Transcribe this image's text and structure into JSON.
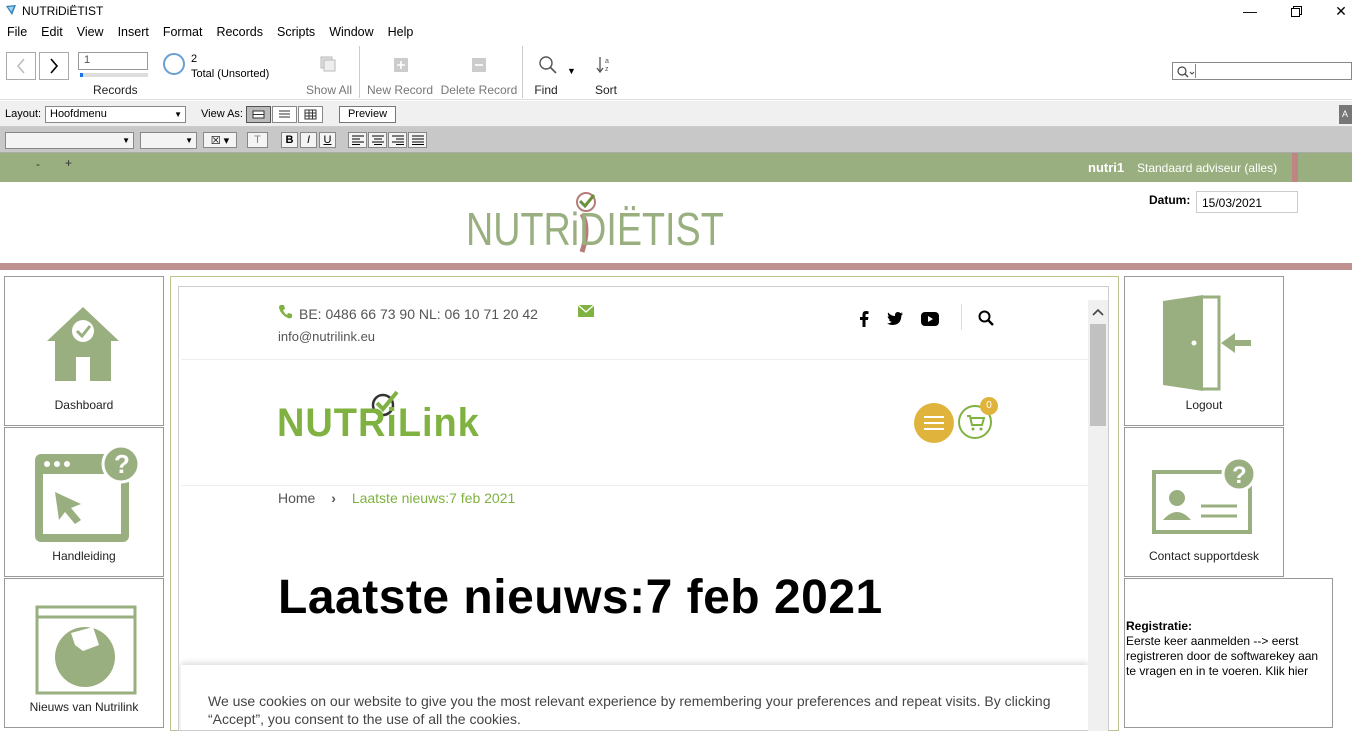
{
  "window": {
    "title": "NUTRiDiËTIST"
  },
  "menu": [
    "File",
    "Edit",
    "View",
    "Insert",
    "Format",
    "Records",
    "Scripts",
    "Window",
    "Help"
  ],
  "toolbar": {
    "record_number": "1",
    "records_label": "Records",
    "total_count": "2",
    "total_label": "Total (Unsorted)",
    "show_all": "Show All",
    "new_record": "New Record",
    "delete_record": "Delete Record",
    "find": "Find",
    "sort": "Sort"
  },
  "layoutbar": {
    "layout_label": "Layout:",
    "layout_value": "Hoofdmenu",
    "view_as_label": "View As:",
    "preview": "Preview",
    "side_button": "A"
  },
  "formatbar": {
    "bold": "B",
    "italic": "I",
    "underline": "U",
    "text_btn": "T"
  },
  "header": {
    "minus": "-",
    "plus": "+",
    "user": "nutri1",
    "role": "Standaard adviseur (alles)",
    "logo_text": "NUTRiDIËTIST",
    "datum_label": "Datum:",
    "datum_value": "15/03/2021"
  },
  "tiles_left": [
    {
      "label": "Dashboard",
      "icon": "home-check-icon"
    },
    {
      "label": "Handleiding",
      "icon": "manual-help-icon"
    },
    {
      "label": "Nieuws van Nutrilink",
      "icon": "news-icon"
    }
  ],
  "tiles_right": [
    {
      "label": "Logout",
      "icon": "logout-door-icon"
    },
    {
      "label": "Contact supportdesk",
      "icon": "support-card-icon"
    }
  ],
  "registration": {
    "title": "Registratie:",
    "text": "Eerste keer aanmelden -->  eerst registreren door de softwarekey aan te vragen en in te voeren. Klik hier"
  },
  "web": {
    "phone": "BE: 0486 66 73 90 NL: 06 10 71 20 42",
    "email": "info@nutrilink.eu",
    "logo_text": "NUTRiLink",
    "cart_count": "0",
    "breadcrumb_home": "Home",
    "breadcrumb_sep": "›",
    "breadcrumb_current": "Laatste nieuws:7 feb 2021",
    "heading": "Laatste nieuws:7 feb 2021",
    "cookie_text": "We use cookies on our website to give you the most relevant experience by remembering your preferences and repeat visits. By clicking “Accept”, you consent to the use of all the cookies."
  },
  "colors": {
    "brand_green": "#9aaf80",
    "nutrilink_green": "#7fb241",
    "pink": "#bf9090",
    "menu_yellow": "#e0b43c"
  }
}
